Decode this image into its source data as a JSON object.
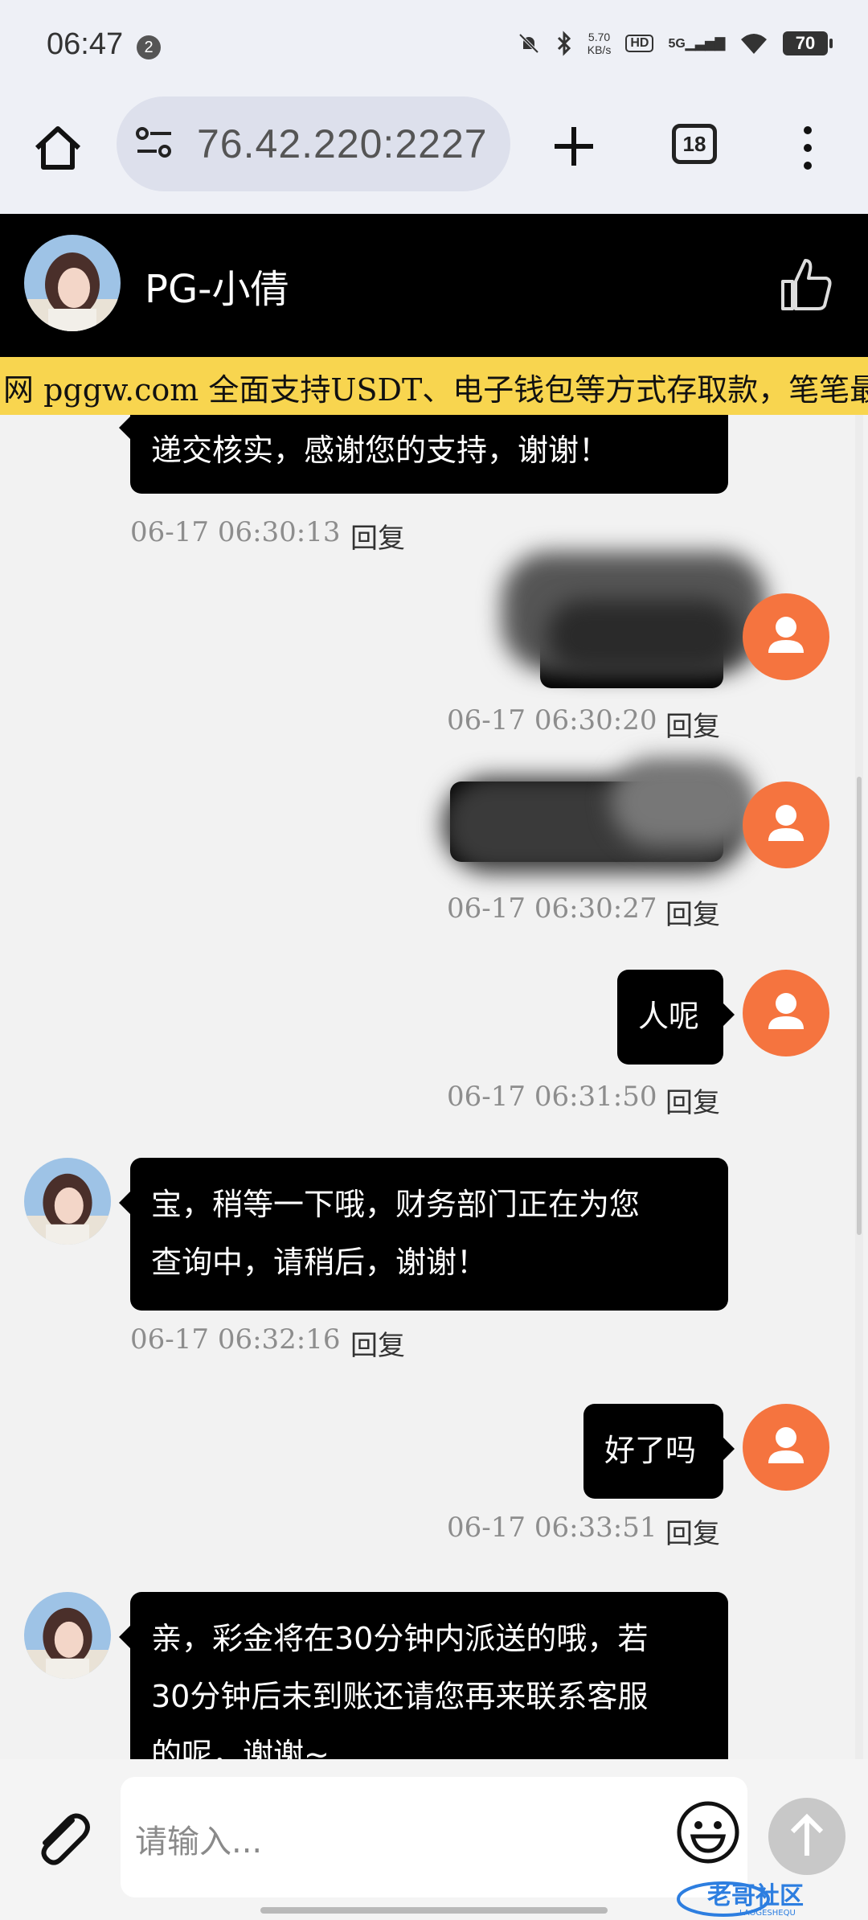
{
  "status_bar": {
    "time": "06:47",
    "notification_count": "2",
    "net_speed_value": "5.70",
    "net_speed_unit": "KB/s",
    "hd_label": "HD",
    "network_label": "5G",
    "battery": "70"
  },
  "browser": {
    "url": "76.42.220:2227",
    "tab_count": "18"
  },
  "chat_header": {
    "title": "PG-小倩"
  },
  "marquee": {
    "text": "网 pggw.com 全面支持USDT、电子钱包等方式存取款，笔笔最"
  },
  "messages": [
    {
      "side": "left",
      "text_lines": [
        "递交核实，感谢您的支持，谢谢！"
      ],
      "time": "06-17 06:30:13",
      "reply_label": "回复"
    },
    {
      "side": "right",
      "blurred": true,
      "time": "06-17 06:30:20",
      "reply_label": "回复"
    },
    {
      "side": "right",
      "blurred": true,
      "time": "06-17 06:30:27",
      "reply_label": "回复"
    },
    {
      "side": "right",
      "text_lines": [
        "人呢"
      ],
      "time": "06-17 06:31:50",
      "reply_label": "回复"
    },
    {
      "side": "left",
      "text_lines": [
        "宝，稍等一下哦，财务部门正在为您",
        "查询中，请稍后，谢谢！"
      ],
      "time": "06-17 06:32:16",
      "reply_label": "回复"
    },
    {
      "side": "right",
      "text_lines": [
        "好了吗"
      ],
      "time": "06-17 06:33:51",
      "reply_label": "回复"
    },
    {
      "side": "left",
      "text_lines": [
        "亲，彩金将在30分钟内派送的哦，若",
        "30分钟后未到账还请您再来联系客服",
        "的呢，谢谢~"
      ]
    }
  ],
  "input": {
    "placeholder": "请输入..."
  },
  "watermark": {
    "text": "老哥社区",
    "subtext": "LAOGESHEQU"
  },
  "colors": {
    "header_bg": "#000000",
    "marquee_bg": "#f8d54f",
    "user_avatar": "#f5743f",
    "bubble_bg": "#000000"
  },
  "icons": [
    "home-icon",
    "site-settings-icon",
    "plus-icon",
    "tabs-icon",
    "more-vert-icon",
    "thumbs-up-icon",
    "user-icon",
    "attach-icon",
    "emoji-icon",
    "send-arrow-icon"
  ]
}
